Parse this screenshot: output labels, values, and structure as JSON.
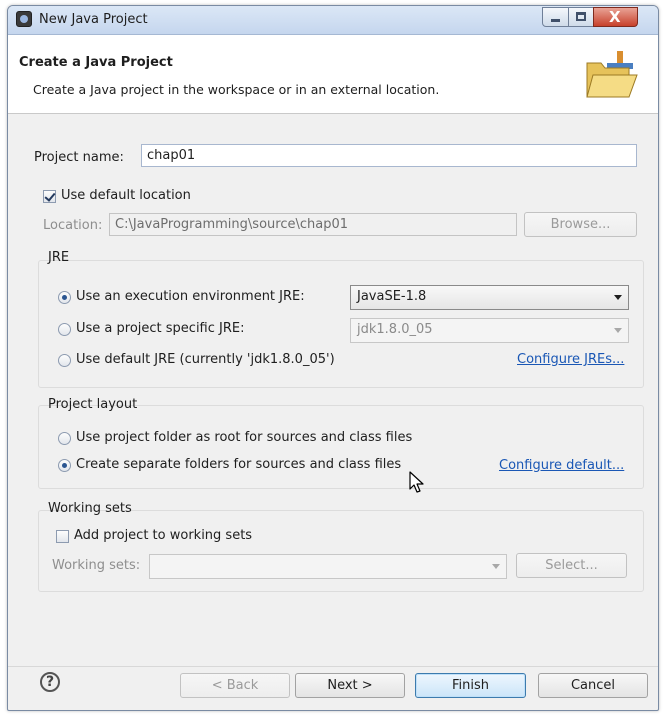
{
  "window": {
    "title": "New Java Project",
    "controls": {
      "minimize": "minimize",
      "maximize": "maximize",
      "close": "X"
    }
  },
  "header": {
    "title": "Create a Java Project",
    "description": "Create a Java project in the workspace or in an external location."
  },
  "project_name": {
    "label": "Project name:",
    "value": "chap01"
  },
  "default_location": {
    "label": "Use default location",
    "checked": true
  },
  "location": {
    "label": "Location:",
    "value": "C:\\JavaProgramming\\source\\chap01",
    "browse_label": "Browse..."
  },
  "jre": {
    "title": "JRE",
    "options": [
      {
        "label": "Use an execution environment JRE:",
        "selected": true
      },
      {
        "label": "Use a project specific JRE:",
        "selected": false
      },
      {
        "label": "Use default JRE (currently 'jdk1.8.0_05')",
        "selected": false
      }
    ],
    "environment_value": "JavaSE-1.8",
    "specific_value": "jdk1.8.0_05",
    "configure_link": "Configure JREs..."
  },
  "layout": {
    "title": "Project layout",
    "options": [
      {
        "label": "Use project folder as root for sources and class files",
        "selected": false
      },
      {
        "label": "Create separate folders for sources and class files",
        "selected": true
      }
    ],
    "configure_link": "Configure default..."
  },
  "working_sets": {
    "title": "Working sets",
    "checkbox_label": "Add project to working sets",
    "checked": false,
    "field_label": "Working sets:",
    "field_value": "",
    "select_label": "Select..."
  },
  "footer": {
    "help": "?",
    "back": "< Back",
    "next": "Next >",
    "finish": "Finish",
    "cancel": "Cancel"
  },
  "icons": {
    "app": "eclipse-icon",
    "header_art": "java-folder-icon",
    "help": "help-icon",
    "cursor": "mouse-pointer-icon"
  },
  "colors": {
    "link": "#1a57b5",
    "titlebar": "#c5d6ee",
    "close_button": "#c7412b"
  }
}
